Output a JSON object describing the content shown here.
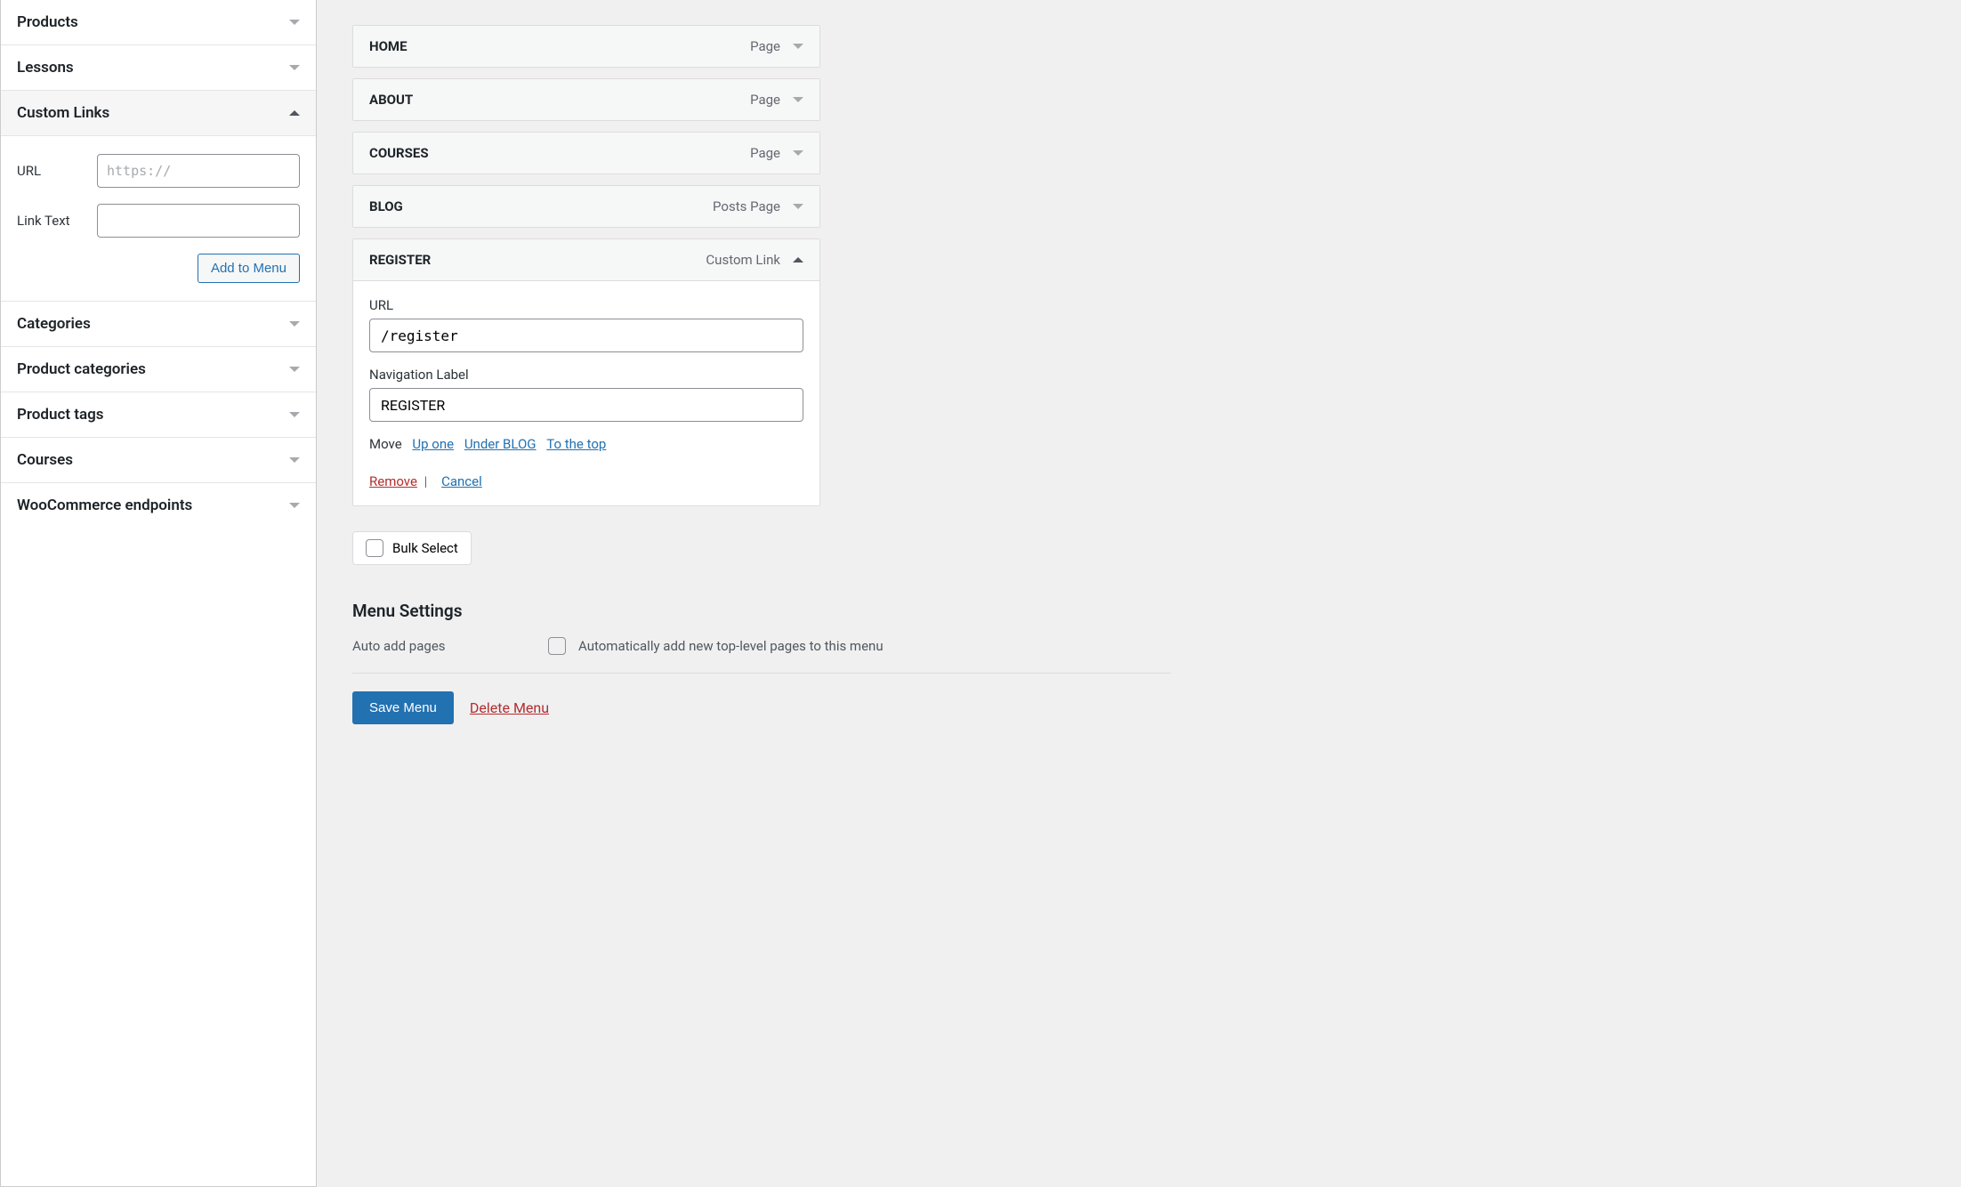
{
  "sidebar": {
    "items": [
      {
        "label": "Products",
        "expanded": false
      },
      {
        "label": "Lessons",
        "expanded": false
      },
      {
        "label": "Custom Links",
        "expanded": true
      },
      {
        "label": "Categories",
        "expanded": false
      },
      {
        "label": "Product categories",
        "expanded": false
      },
      {
        "label": "Product tags",
        "expanded": false
      },
      {
        "label": "Courses",
        "expanded": false
      },
      {
        "label": "WooCommerce endpoints",
        "expanded": false
      }
    ],
    "custom_links": {
      "url_label": "URL",
      "url_placeholder": "https://",
      "link_text_label": "Link Text",
      "add_button": "Add to Menu"
    }
  },
  "menu": {
    "items": [
      {
        "title": "HOME",
        "type": "Page",
        "expanded": false
      },
      {
        "title": "ABOUT",
        "type": "Page",
        "expanded": false
      },
      {
        "title": "COURSES",
        "type": "Page",
        "expanded": false
      },
      {
        "title": "BLOG",
        "type": "Posts Page",
        "expanded": false
      },
      {
        "title": "REGISTER",
        "type": "Custom Link",
        "expanded": true,
        "url_label": "URL",
        "url_value": "/register",
        "nav_label_label": "Navigation Label",
        "nav_label_value": "REGISTER",
        "move_label": "Move",
        "move_up": "Up one",
        "move_under": "Under BLOG",
        "move_top": "To the top",
        "remove_label": "Remove",
        "cancel_label": "Cancel"
      }
    ],
    "bulk_select": "Bulk Select",
    "settings_title": "Menu Settings",
    "auto_add_label": "Auto add pages",
    "auto_add_text": "Automatically add new top-level pages to this menu",
    "save_button": "Save Menu",
    "delete_link": "Delete Menu"
  }
}
